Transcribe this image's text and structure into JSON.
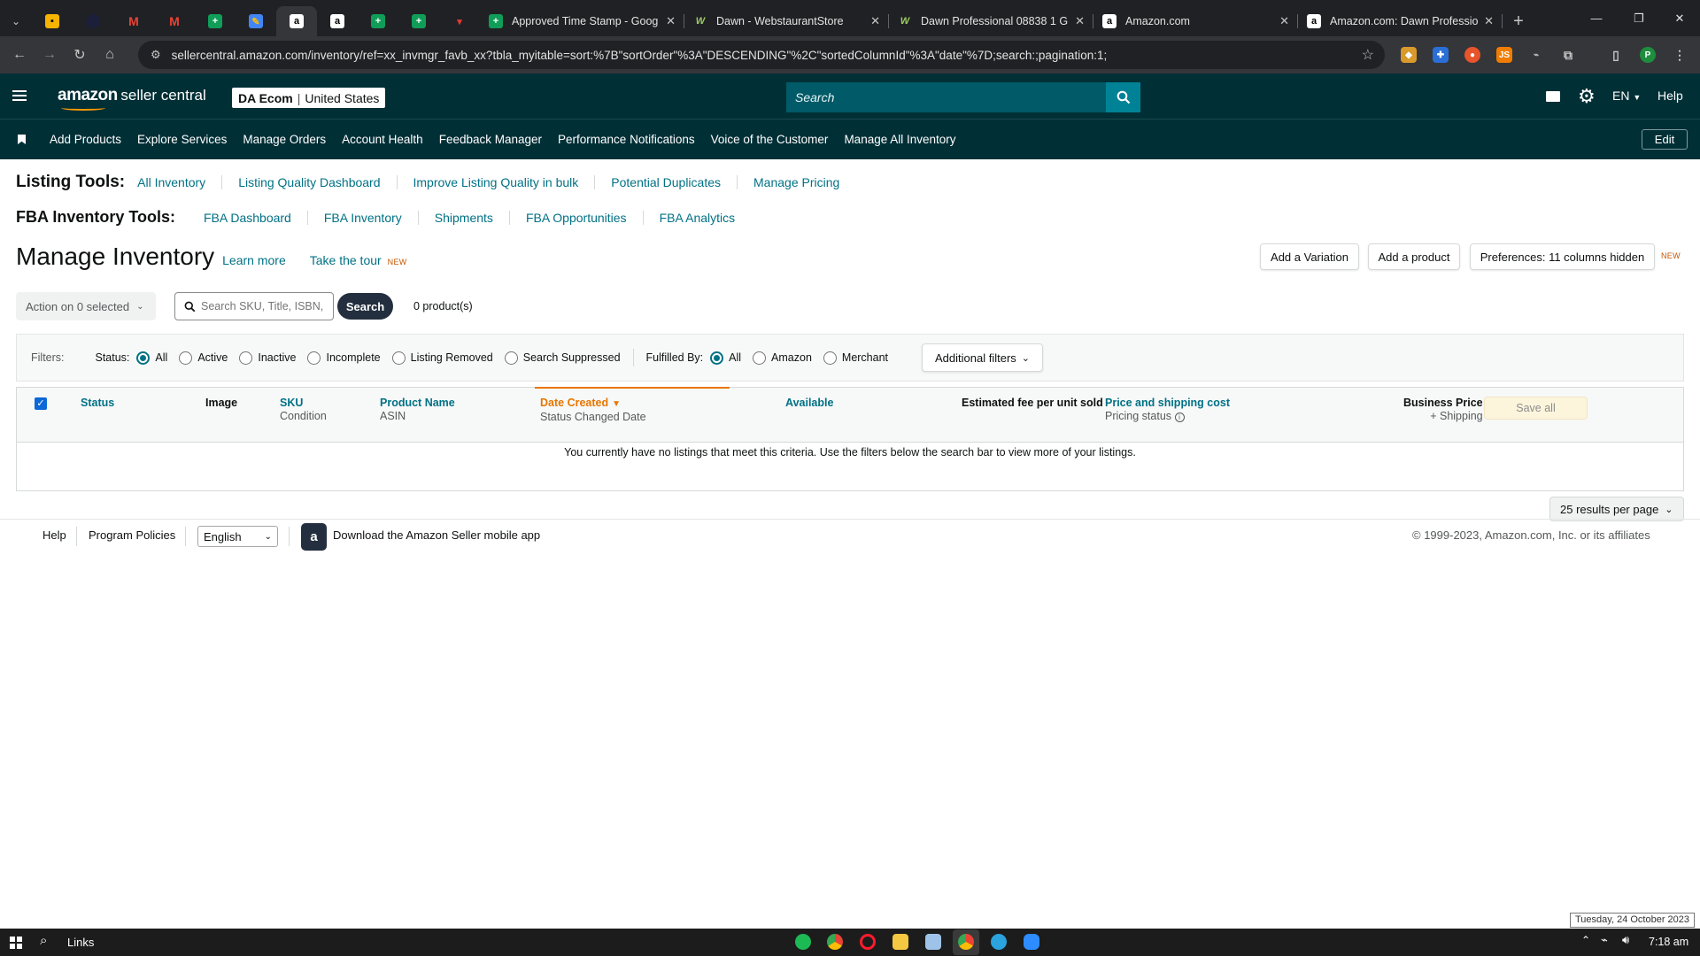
{
  "browser": {
    "tabs": [
      {
        "title": "Approved Time Stamp - Goog"
      },
      {
        "title": "Dawn - WebstaurantStore"
      },
      {
        "title": "Dawn Professional 08838 1 G"
      },
      {
        "title": "Amazon.com"
      },
      {
        "title": "Amazon.com: Dawn Professio"
      }
    ],
    "url": "sellercentral.amazon.com/inventory/ref=xx_invmgr_favb_xx?tbla_myitable=sort:%7B\"sortOrder\"%3A\"DESCENDING\"%2C\"sortedColumnId\"%3A\"date\"%7D;search:;pagination:1;",
    "profile_initial": "P"
  },
  "header": {
    "logo_amazon": "amazon",
    "logo_seller": "seller central",
    "account_name": "DA Ecom",
    "account_region": "United States",
    "search_placeholder": "Search",
    "lang": "EN",
    "help": "Help"
  },
  "nav": {
    "items": [
      "Add Products",
      "Explore Services",
      "Manage Orders",
      "Account Health",
      "Feedback Manager",
      "Performance Notifications",
      "Voice of the Customer",
      "Manage All Inventory"
    ],
    "edit": "Edit"
  },
  "listing_tools": {
    "label": "Listing Tools:",
    "links": [
      "All Inventory",
      "Listing Quality Dashboard",
      "Improve Listing Quality in bulk",
      "Potential Duplicates",
      "Manage Pricing"
    ]
  },
  "fba_tools": {
    "label": "FBA Inventory Tools:",
    "links": [
      "FBA Dashboard",
      "FBA Inventory",
      "Shipments",
      "FBA Opportunities",
      "FBA Analytics"
    ]
  },
  "page": {
    "title": "Manage Inventory",
    "learn_more": "Learn more",
    "take_tour": "Take the tour",
    "new_badge": "NEW",
    "add_variation": "Add a Variation",
    "add_product": "Add a product",
    "preferences": "Preferences: 11 columns hidden"
  },
  "actions": {
    "action_select": "Action on 0 selected",
    "search_placeholder": "Search SKU, Title, ISBN,",
    "search_button": "Search",
    "product_count": "0 product(s)"
  },
  "filters": {
    "label": "Filters:",
    "status_label": "Status:",
    "status_options": [
      "All",
      "Active",
      "Inactive",
      "Incomplete",
      "Listing Removed",
      "Search Suppressed"
    ],
    "status_selected": "All",
    "fulfilled_label": "Fulfilled By:",
    "fulfilled_options": [
      "All",
      "Amazon",
      "Merchant"
    ],
    "fulfilled_selected": "All",
    "additional": "Additional filters"
  },
  "table": {
    "headers": {
      "status": "Status",
      "image": "Image",
      "sku": "SKU",
      "sku_sub": "Condition",
      "product_name": "Product Name",
      "product_sub": "ASIN",
      "date_created": "Date Created",
      "date_sub": "Status Changed Date",
      "available": "Available",
      "est_fee": "Estimated fee per unit sold",
      "price": "Price and shipping cost",
      "price_sub": "Pricing status",
      "business_price": "Business Price",
      "business_sub": "+ Shipping",
      "save_all": "Save all"
    },
    "empty_message": "You currently have no listings that meet this criteria. Use the filters below the search bar to view more of your listings.",
    "results_per_page": "25 results per page"
  },
  "footer": {
    "help": "Help",
    "program_policies": "Program Policies",
    "language": "English",
    "mobile_app": "Download the Amazon Seller mobile app",
    "copyright": "© 1999-2023, Amazon.com, Inc. or its affiliates"
  },
  "taskbar": {
    "links": "Links",
    "time": "7:18 am",
    "date_tooltip": "Tuesday, 24 October 2023"
  },
  "colors": {
    "header_bg": "#002f36",
    "link": "#007185",
    "search_btn": "#008296",
    "sort_accent": "#e77600"
  }
}
